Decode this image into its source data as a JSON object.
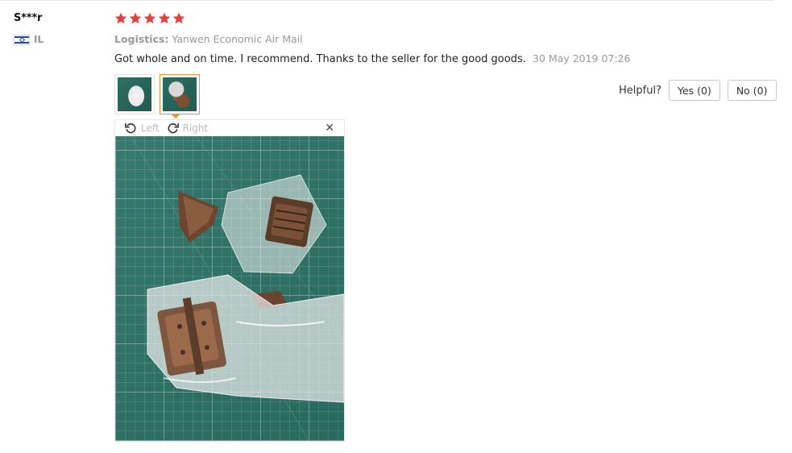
{
  "review": {
    "username": "S***r",
    "country": "IL",
    "rating": 5,
    "logistics_label": "Logistics:",
    "logistics_value": "Yanwen Economic Air Mail",
    "text": "Got whole and on time. I recommend. Thanks to the seller for the good goods.",
    "date": "30 May 2019 07:26"
  },
  "helpful": {
    "label": "Helpful?",
    "yes": "Yes (0)",
    "no": "No (0)"
  },
  "viewer": {
    "rotate_left": "Left",
    "rotate_right": "Right",
    "close_icon": "close-icon",
    "active_thumb": 2
  },
  "colors": {
    "star": "#e5413b",
    "thumb_active_border": "#f58a3b",
    "muted_text": "#999999"
  }
}
